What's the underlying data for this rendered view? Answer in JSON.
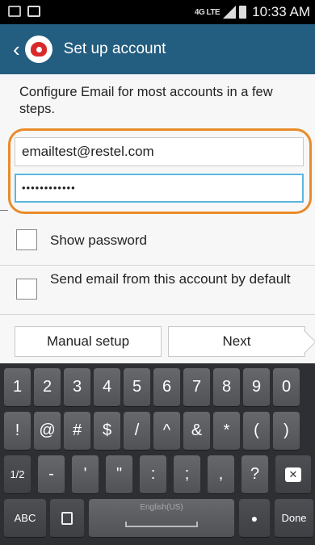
{
  "status_bar": {
    "network": "4G LTE",
    "time": "10:33 AM"
  },
  "action_bar": {
    "title": "Set up account"
  },
  "form": {
    "intro": "Configure Email for most accounts in a few steps.",
    "email_value": "emailtest@restel.com",
    "password_value": "••••••••••••",
    "show_password_label": "Show password",
    "default_label": "Send email from this account by default",
    "manual_setup_label": "Manual setup",
    "next_label": "Next"
  },
  "keyboard": {
    "row1": [
      "1",
      "2",
      "3",
      "4",
      "5",
      "6",
      "7",
      "8",
      "9",
      "0"
    ],
    "row2": [
      "!",
      "@",
      "#",
      "$",
      "/",
      "^",
      "&",
      "*",
      "(",
      ")"
    ],
    "row3": [
      "1/2",
      "-",
      "'",
      "\"",
      ":",
      ";",
      ",",
      "?"
    ],
    "abc_label": "ABC",
    "space_label": "English(US)",
    "done_label": "Done"
  },
  "colors": {
    "action_bar": "#235d7f",
    "highlight": "#e98b2a",
    "focus": "#5bb7e0"
  }
}
